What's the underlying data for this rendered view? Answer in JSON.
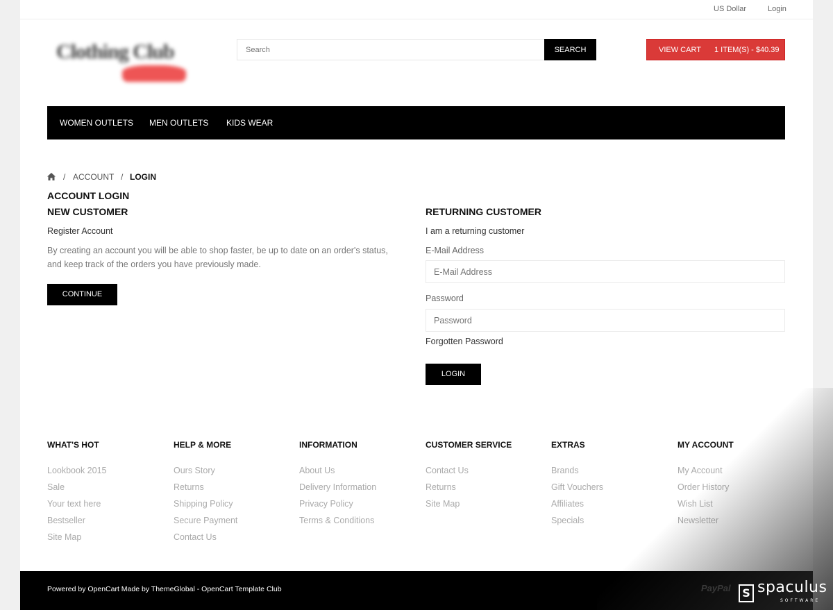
{
  "topbar": {
    "currency": "US Dollar",
    "login": "Login"
  },
  "header": {
    "logo_text": "Clothing Club",
    "search_placeholder": "Search",
    "search_button": "SEARCH",
    "cart_label": "VIEW CART",
    "cart_summary": "1 ITEM(S) - $40.39"
  },
  "nav": {
    "items": [
      "WOMEN OUTLETS",
      "MEN OUTLETS",
      "KIDS WEAR"
    ]
  },
  "breadcrumb": {
    "sep": "/",
    "account": "ACCOUNT",
    "login": "LOGIN"
  },
  "page_title": "ACCOUNT LOGIN",
  "new_customer": {
    "heading": "NEW CUSTOMER",
    "subheading": "Register Account",
    "description": "By creating an account you will be able to shop faster, be up to date on an order's status, and keep track of the orders you have previously made.",
    "button": "CONTINUE"
  },
  "returning_customer": {
    "heading": "RETURNING CUSTOMER",
    "subheading": "I am a returning customer",
    "email_label": "E-Mail Address",
    "email_placeholder": "E-Mail Address",
    "password_label": "Password",
    "password_placeholder": "Password",
    "forgot": "Forgotten Password",
    "button": "LOGIN"
  },
  "footer_columns": [
    {
      "heading": "WHAT'S HOT",
      "links": [
        "Lookbook 2015",
        "Sale",
        "Your text here",
        "Bestseller",
        "Site Map"
      ]
    },
    {
      "heading": "HELP & MORE",
      "links": [
        "Ours Story",
        "Returns",
        "Shipping Policy",
        "Secure Payment",
        "Contact Us"
      ]
    },
    {
      "heading": "INFORMATION",
      "links": [
        "About Us",
        "Delivery Information",
        "Privacy Policy",
        "Terms & Conditions"
      ]
    },
    {
      "heading": "CUSTOMER SERVICE",
      "links": [
        "Contact Us",
        "Returns",
        "Site Map"
      ]
    },
    {
      "heading": "EXTRAS",
      "links": [
        "Brands",
        "Gift Vouchers",
        "Affiliates",
        "Specials"
      ]
    },
    {
      "heading": "MY ACCOUNT",
      "links": [
        "My Account",
        "Order History",
        "Wish List",
        "Newsletter"
      ]
    }
  ],
  "footer": {
    "copyright": "Powered by OpenCart Made by ThemeGlobal - OpenCart Template Club",
    "payment_logo": "PayPal"
  },
  "watermark": {
    "mark": "S",
    "name": "spaculus",
    "sub": "SOFTWARE"
  },
  "colors": {
    "accent": "#da3a38",
    "dark": "#000000"
  }
}
